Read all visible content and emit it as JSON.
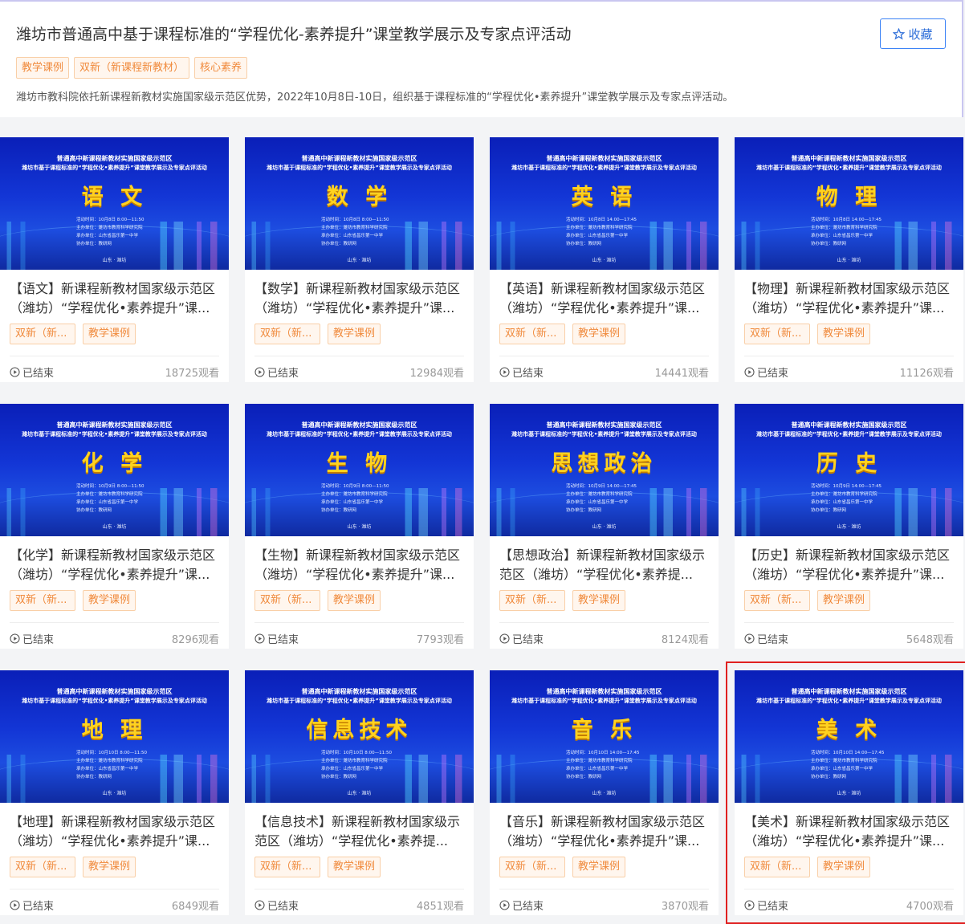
{
  "header": {
    "title": "潍坊市普通高中基于课程标准的“学程优化-素养提升”课堂教学展示及专家点评活动",
    "favorite_label": "收藏",
    "tags": [
      "教学课例",
      "双新（新课程新教材）",
      "核心素养"
    ],
    "description": "潍坊市教科院依托新课程新教材实施国家级示范区优势，2022年10月8日-10日，组织基于课程标准的“学程优化•素养提升”课堂教学展示及专家点评活动。"
  },
  "thumb_common": {
    "headline1": "普通高中新课程新教材实施国家级示范区",
    "headline2": "潍坊市基于课程标准的“学程优化•素养提升”课堂教学展示及专家点评活动",
    "host": "主办单位：潍坊市教育科学研究院",
    "undertake": "承办单位：山东省昌乐第一中学",
    "assist": "协办单位：教研网",
    "sign": "山东 · 潍坊"
  },
  "cards": [
    {
      "subject": "语 文",
      "time": "活动时间：10月8日 8:00—11:50",
      "title": "【语文】新课程新教材国家级示范区（潍坊）“学程优化•素养提升”课...",
      "tag1": "双新（新...",
      "tag2": "教学课例",
      "status": "已结束",
      "views": "18725观看"
    },
    {
      "subject": "数 学",
      "time": "活动时间：10月8日 8:00—11:50",
      "title": "【数学】新课程新教材国家级示范区（潍坊）“学程优化•素养提升”课...",
      "tag1": "双新（新...",
      "tag2": "教学课例",
      "status": "已结束",
      "views": "12984观看"
    },
    {
      "subject": "英 语",
      "time": "活动时间：10月8日 14:00—17:45",
      "title": "【英语】新课程新教材国家级示范区（潍坊）“学程优化•素养提升”课...",
      "tag1": "双新（新...",
      "tag2": "教学课例",
      "status": "已结束",
      "views": "14441观看"
    },
    {
      "subject": "物 理",
      "time": "活动时间：10月8日 14:00—17:45",
      "title": "【物理】新课程新教材国家级示范区（潍坊）“学程优化•素养提升”课...",
      "tag1": "双新（新...",
      "tag2": "教学课例",
      "status": "已结束",
      "views": "11126观看"
    },
    {
      "subject": "化 学",
      "time": "活动时间：10月9日 8:00—11:50",
      "title": "【化学】新课程新教材国家级示范区（潍坊）“学程优化•素养提升”课...",
      "tag1": "双新（新...",
      "tag2": "教学课例",
      "status": "已结束",
      "views": "8296观看"
    },
    {
      "subject": "生 物",
      "time": "活动时间：10月9日 8:00—11:50",
      "title": "【生物】新课程新教材国家级示范区（潍坊）“学程优化•素养提升”课...",
      "tag1": "双新（新...",
      "tag2": "教学课例",
      "status": "已结束",
      "views": "7793观看"
    },
    {
      "subject": "思想政治",
      "time": "活动时间：10月9日 14:00—17:45",
      "title": "【思想政治】新课程新教材国家级示范区（潍坊）“学程优化•素养提...",
      "tag1": "双新（新...",
      "tag2": "教学课例",
      "status": "已结束",
      "views": "8124观看"
    },
    {
      "subject": "历 史",
      "time": "活动时间：10月9日 14:00—17:45",
      "title": "【历史】新课程新教材国家级示范区（潍坊）“学程优化•素养提升”课...",
      "tag1": "双新（新...",
      "tag2": "教学课例",
      "status": "已结束",
      "views": "5648观看"
    },
    {
      "subject": "地 理",
      "time": "活动时间：10月10日 8:00—11:50",
      "title": "【地理】新课程新教材国家级示范区（潍坊）“学程优化•素养提升”课...",
      "tag1": "双新（新...",
      "tag2": "教学课例",
      "status": "已结束",
      "views": "6849观看"
    },
    {
      "subject": "信息技术",
      "time": "活动时间：10月10日 8:00—11:50",
      "title": "【信息技术】新课程新教材国家级示范区（潍坊）“学程优化•素养提...",
      "tag1": "双新（新...",
      "tag2": "教学课例",
      "status": "已结束",
      "views": "4851观看"
    },
    {
      "subject": "音 乐",
      "time": "活动时间：10月10日 14:00—17:45",
      "title": "【音乐】新课程新教材国家级示范区（潍坊）“学程优化•素养提升”课...",
      "tag1": "双新（新...",
      "tag2": "教学课例",
      "status": "已结束",
      "views": "3870观看"
    },
    {
      "subject": "美 术",
      "time": "活动时间：10月10日 14:00—17:45",
      "title": "【美术】新课程新教材国家级示范区（潍坊）“学程优化•素养提升”课...",
      "tag1": "双新（新...",
      "tag2": "教学课例",
      "status": "已结束",
      "views": "4700观看"
    }
  ]
}
